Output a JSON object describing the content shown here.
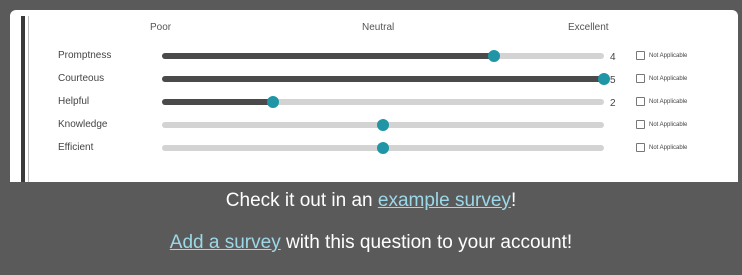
{
  "scale": {
    "poor": "Poor",
    "neutral": "Neutral",
    "excellent": "Excellent"
  },
  "rows": [
    {
      "label": "Promptness",
      "value": 4,
      "value_text": "4",
      "fraction": 0.75,
      "answered": true,
      "na_label": "Not Applicable"
    },
    {
      "label": "Courteous",
      "value": 5,
      "value_text": "5",
      "fraction": 1.0,
      "answered": true,
      "na_label": "Not Applicable"
    },
    {
      "label": "Helpful",
      "value": 2,
      "value_text": "2",
      "fraction": 0.25,
      "answered": true,
      "na_label": "Not Applicable"
    },
    {
      "label": "Knowledge",
      "value_text": "",
      "fraction": 0.5,
      "answered": false,
      "na_label": "Not Applicable"
    },
    {
      "label": "Efficient",
      "value_text": "",
      "fraction": 0.5,
      "answered": false,
      "na_label": "Not Applicable"
    }
  ],
  "footer": {
    "line1_prefix": "Check it out in an ",
    "line1_link": "example survey",
    "line1_suffix": "!",
    "line2_link": "Add a survey",
    "line2_suffix": " with this question to your account!"
  },
  "colors": {
    "accent": "#1f95a5",
    "fill": "#4a4a4a",
    "track": "#d3d3d3",
    "background": "#5a5a5a",
    "link": "#9dd8e8"
  }
}
